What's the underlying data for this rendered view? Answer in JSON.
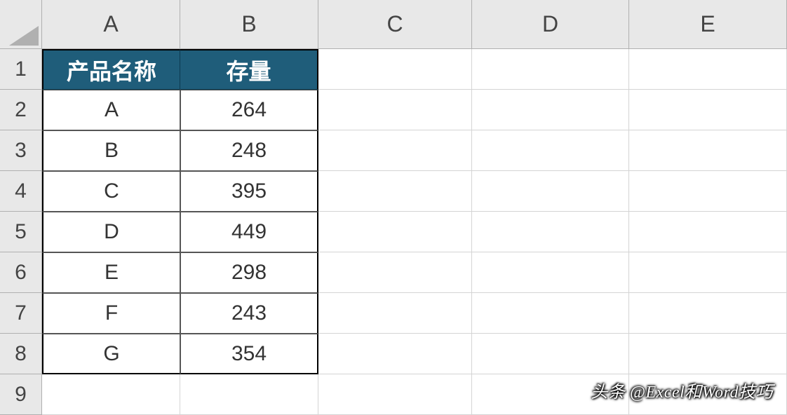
{
  "columns": [
    "A",
    "B",
    "C",
    "D",
    "E"
  ],
  "rows": [
    "1",
    "2",
    "3",
    "4",
    "5",
    "6",
    "7",
    "8",
    "9"
  ],
  "table": {
    "headers": [
      "产品名称",
      "存量"
    ],
    "data": [
      {
        "name": "A",
        "value": "264"
      },
      {
        "name": "B",
        "value": "248"
      },
      {
        "name": "C",
        "value": "395"
      },
      {
        "name": "D",
        "value": "449"
      },
      {
        "name": "E",
        "value": "298"
      },
      {
        "name": "F",
        "value": "243"
      },
      {
        "name": "G",
        "value": "354"
      }
    ]
  },
  "watermark": "头条 @Excel和Word技巧"
}
